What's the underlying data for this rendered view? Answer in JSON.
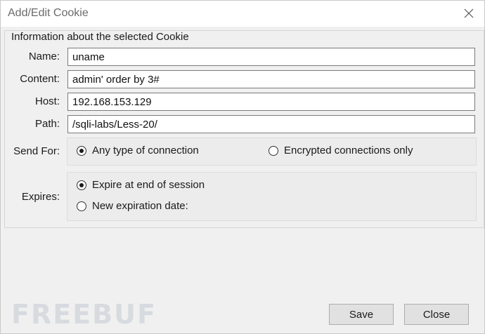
{
  "window": {
    "title": "Add/Edit Cookie"
  },
  "group": {
    "title": "Information about the selected Cookie"
  },
  "fields": {
    "name": {
      "label": "Name:",
      "value": "uname"
    },
    "content": {
      "label": "Content:",
      "value": "admin' order by 3#"
    },
    "host": {
      "label": "Host:",
      "value": "192.168.153.129"
    },
    "path": {
      "label": "Path:",
      "value": "/sqli-labs/Less-20/"
    }
  },
  "send_for": {
    "label": "Send For:",
    "options": [
      {
        "label": "Any type of connection",
        "selected": true
      },
      {
        "label": "Encrypted connections only",
        "selected": false
      }
    ]
  },
  "expires": {
    "label": "Expires:",
    "options": [
      {
        "label": "Expire at end of session",
        "selected": true
      },
      {
        "label": "New expiration date:",
        "selected": false
      }
    ]
  },
  "buttons": {
    "save": "Save",
    "close": "Close"
  },
  "watermark": {
    "text": "FREEBUF"
  },
  "icons": {
    "close": "close-icon"
  }
}
